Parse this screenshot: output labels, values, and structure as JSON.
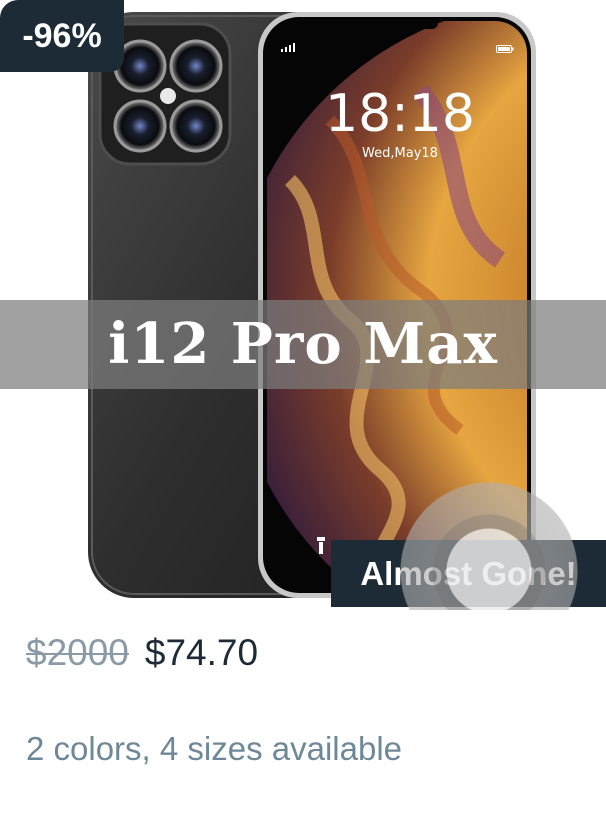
{
  "product": {
    "discount_badge": "-96%",
    "title": "i12 Pro Max",
    "stock_badge": "Almost Gone!",
    "original_price": "$2000",
    "sale_price": "$74.70",
    "availability": "2 colors, 4 sizes available"
  },
  "phone_screen": {
    "time": "18:18",
    "date": "Wed,May18"
  },
  "colors": {
    "badge_bg": "#1d2b36",
    "muted_text": "#6f8898",
    "strike_price": "#8a9aa6",
    "price_text": "#1d2b36"
  },
  "icons": [
    "signal-icon",
    "battery-icon",
    "flashlight-icon"
  ]
}
